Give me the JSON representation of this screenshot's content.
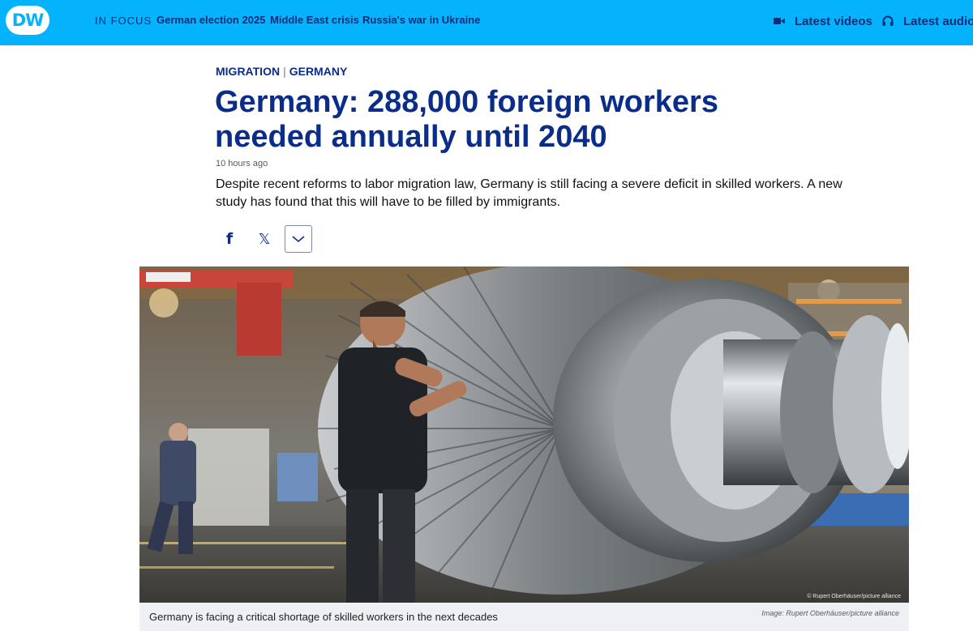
{
  "header": {
    "logo_text": "DW",
    "in_focus_label": "IN FOCUS",
    "topics": [
      "German election 2025",
      "Middle East crisis",
      "Russia's war in Ukraine"
    ],
    "latest_videos_label": "Latest videos",
    "latest_audio_label": "Latest audio",
    "brand_color": "#05b2fc",
    "nav_text_color": "#0a2d7a"
  },
  "article": {
    "kicker": [
      "MIGRATION",
      "GERMANY"
    ],
    "kicker_separator": "|",
    "headline": "Germany: 288,000 foreign workers needed annually until 2040",
    "timestamp": "10 hours ago",
    "teaser": "Despite recent reforms to labor migration law, Germany is still facing a severe deficit in skilled workers. A new study has found that this will have to be filled by immigrants.",
    "headline_color": "#0a2d8a"
  },
  "share": {
    "icons": [
      "facebook-icon",
      "x-icon",
      "chevron-down-icon"
    ],
    "facebook_glyph": "f",
    "x_glyph": "𝕏"
  },
  "image": {
    "watermark": "© Rupert Oberhäuser/picture alliance",
    "caption": "Germany is facing a critical shortage of skilled workers in the next decades",
    "credit": "Image: Rupert Oberhäuser/picture alliance"
  }
}
